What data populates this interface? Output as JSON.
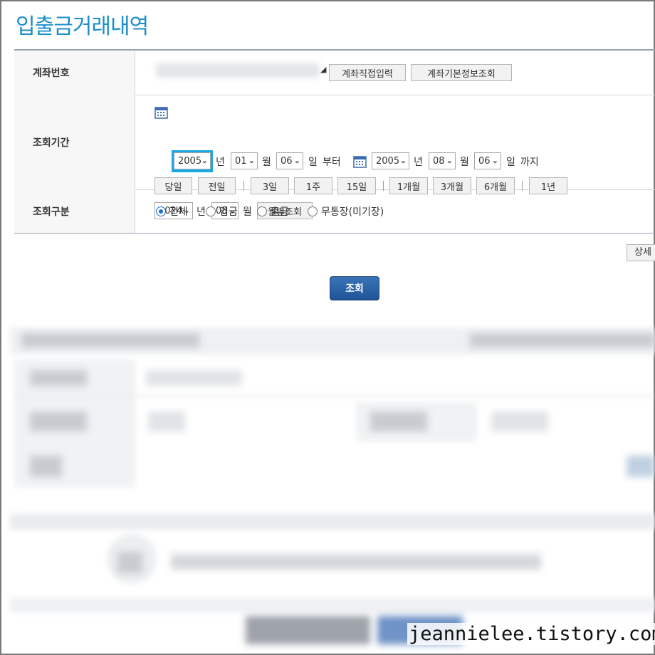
{
  "page": {
    "title": "입출금거래내역"
  },
  "account": {
    "label": "계좌번호",
    "direct_input_button": "계좌직접입력",
    "basic_info_button": "계좌기본정보조회"
  },
  "period": {
    "label": "조회기간",
    "from": {
      "year": "2005",
      "year_unit": "년",
      "month": "01",
      "month_unit": "월",
      "day": "06",
      "day_unit": "일",
      "suffix": "부터"
    },
    "to": {
      "year": "2005",
      "year_unit": "년",
      "month": "08",
      "month_unit": "월",
      "day": "06",
      "day_unit": "일",
      "suffix": "까지"
    },
    "quick": {
      "today": "당일",
      "yesterday": "전일",
      "d3": "3일",
      "w1": "1주",
      "d15": "15일",
      "m1": "1개월",
      "m3": "3개월",
      "m6": "6개월",
      "y1": "1년"
    },
    "monthly": {
      "year": "2024",
      "year_unit": "년",
      "month": "08",
      "month_unit": "월",
      "button": "월별조회"
    }
  },
  "type": {
    "label": "조회구분",
    "options": [
      {
        "label": "전체",
        "checked": true
      },
      {
        "label": "입금",
        "checked": false
      },
      {
        "label": "출금",
        "checked": false
      },
      {
        "label": "무통장(미기장)",
        "checked": false
      }
    ]
  },
  "detail_button": "상세",
  "lookup_button": "조회",
  "watermark": "jeannielee.tistory.com",
  "colors": {
    "title": "#1a8fc9",
    "primary_button": "#2a62a8",
    "focus": "#19a7e6",
    "radio": "#1d6fd6"
  }
}
